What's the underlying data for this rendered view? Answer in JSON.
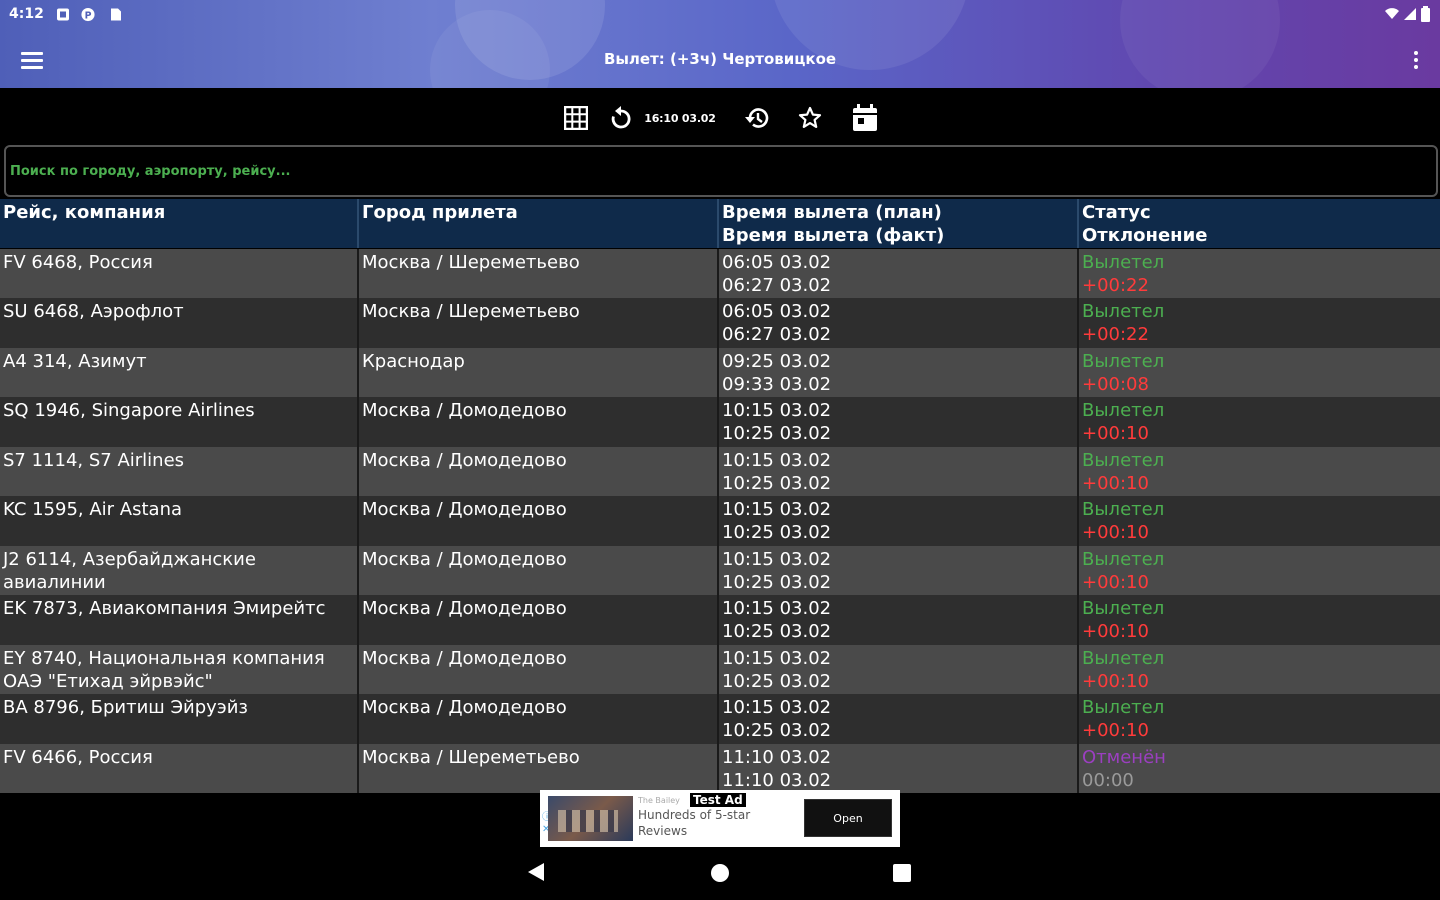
{
  "status_bar": {
    "time": "4:12"
  },
  "app_bar": {
    "title": "Вылет: (+3ч) Чертовицкое"
  },
  "toolbar": {
    "time": "16:10 03.02"
  },
  "search": {
    "placeholder": "Поиск по городу, аэропорту, рейсу..."
  },
  "table": {
    "headers": {
      "flight": "Рейс, компания",
      "city": "Город прилета",
      "time_plan": "Время вылета (план)",
      "time_fact": "Время вылета (факт)",
      "status": "Статус",
      "deviation": "Отклонение"
    },
    "rows": [
      {
        "flight": "FV 6468, Россия",
        "city": "Москва / Шереметьево",
        "plan": "06:05 03.02",
        "fact": "06:27 03.02",
        "status": "Вылетел",
        "delta": "+00:22"
      },
      {
        "flight": "SU 6468, Аэрофлот",
        "city": "Москва / Шереметьево",
        "plan": "06:05 03.02",
        "fact": "06:27 03.02",
        "status": "Вылетел",
        "delta": "+00:22"
      },
      {
        "flight": "A4 314, Азимут",
        "city": "Краснодар",
        "plan": "09:25 03.02",
        "fact": "09:33 03.02",
        "status": "Вылетел",
        "delta": "+00:08"
      },
      {
        "flight": "SQ 1946, Singapore Airlines",
        "city": "Москва / Домодедово",
        "plan": "10:15 03.02",
        "fact": "10:25 03.02",
        "status": "Вылетел",
        "delta": "+00:10"
      },
      {
        "flight": "S7 1114, S7 Airlines",
        "city": "Москва / Домодедово",
        "plan": "10:15 03.02",
        "fact": "10:25 03.02",
        "status": "Вылетел",
        "delta": "+00:10"
      },
      {
        "flight": "KC 1595, Air Astana",
        "city": "Москва / Домодедово",
        "plan": "10:15 03.02",
        "fact": "10:25 03.02",
        "status": "Вылетел",
        "delta": "+00:10"
      },
      {
        "flight": "J2 6114, Азербайджанские авиалинии",
        "city": "Москва / Домодедово",
        "plan": "10:15 03.02",
        "fact": "10:25 03.02",
        "status": "Вылетел",
        "delta": "+00:10"
      },
      {
        "flight": "EK 7873, Авиакомпания Эмирейтс",
        "city": "Москва / Домодедово",
        "plan": "10:15 03.02",
        "fact": "10:25 03.02",
        "status": "Вылетел",
        "delta": "+00:10"
      },
      {
        "flight": "EY 8740, Национальная компания ОАЭ \"Етихад эйрвэйс\"",
        "city": "Москва / Домодедово",
        "plan": "10:15 03.02",
        "fact": "10:25 03.02",
        "status": "Вылетел",
        "delta": "+00:10"
      },
      {
        "flight": "BA 8796, Бритиш Эйруэйз",
        "city": "Москва / Домодедово",
        "plan": "10:15 03.02",
        "fact": "10:25 03.02",
        "status": "Вылетел",
        "delta": "+00:10"
      },
      {
        "flight": "FV 6466, Россия",
        "city": "Москва / Шереметьево",
        "plan": "11:10 03.02",
        "fact": "11:10 03.02",
        "status": "Отменён",
        "delta": "00:00"
      }
    ]
  },
  "ad": {
    "tag": "Test Ad",
    "small": "The Bailey",
    "text": "Hundreds of 5-star Reviews",
    "open_label": "Open"
  },
  "colors": {
    "departed": "#4caf50",
    "delay": "#ff3b3b",
    "cancelled": "#9b3fc0",
    "zero_delta": "#9a9a9a",
    "header_bg": "#0f2a4a"
  }
}
